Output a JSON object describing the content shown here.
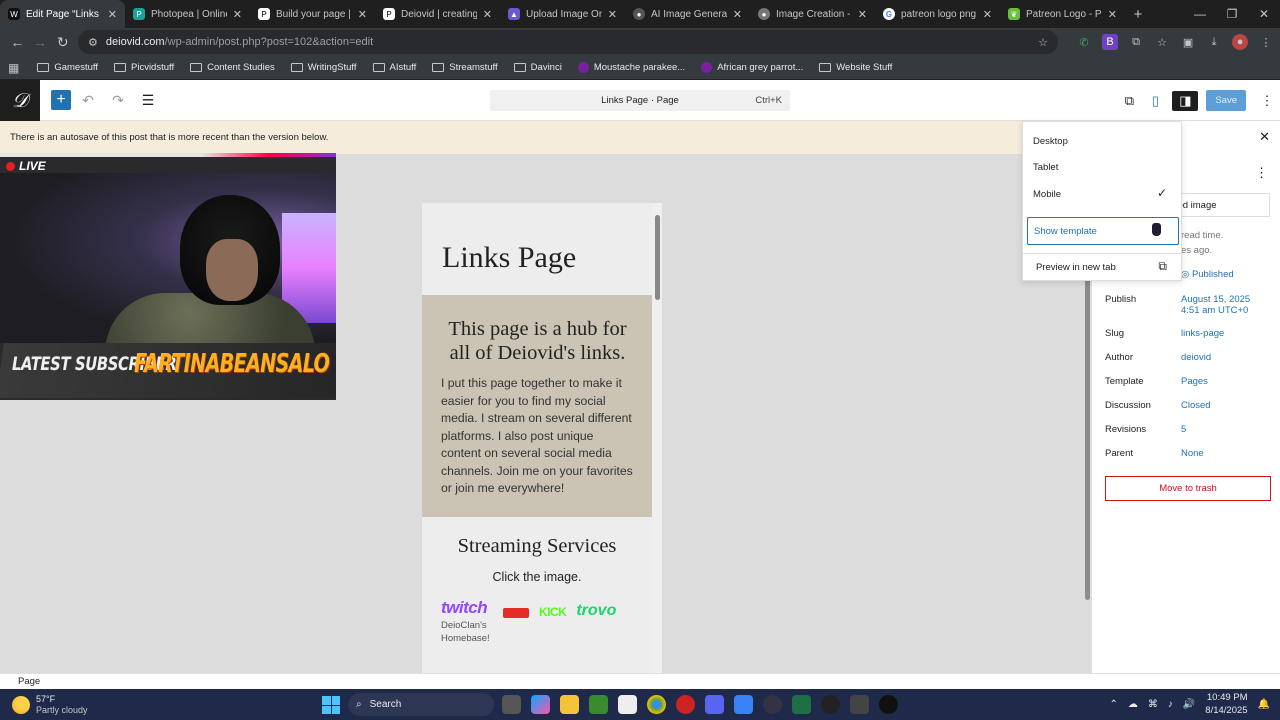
{
  "browser": {
    "tabs": [
      {
        "label": "Edit Page “Links Page”",
        "icon": "wordpress-icon",
        "color": "#353a3f",
        "active": true
      },
      {
        "label": "Photopea | Online Photo",
        "icon": "photopea-icon",
        "color": "#18a497"
      },
      {
        "label": "Build your page | Patreon",
        "icon": "patreon-icon",
        "color": "#1f1f1f"
      },
      {
        "label": "Deiovid | creating Stre",
        "icon": "patreon-icon",
        "color": "#1f1f1f"
      },
      {
        "label": "Upload Image Online",
        "icon": "upload-icon",
        "color": "#6a5acd"
      },
      {
        "label": "AI Image Generator -",
        "icon": "ai-icon",
        "color": "#555"
      },
      {
        "label": "Image Creation - Leon",
        "icon": "leonardo-icon",
        "color": "#777"
      },
      {
        "label": "patreon logo png - G",
        "icon": "google-icon",
        "color": "#fff"
      },
      {
        "label": "Patreon Logo - Patre",
        "icon": "leaf-icon",
        "color": "#6bbf3b"
      }
    ],
    "url_domain": "deiovid.com",
    "url_path": "/wp-admin/post.php?post=102&action=edit",
    "bookmarks": [
      {
        "label": "Gamestuff",
        "icon": "folder-icon"
      },
      {
        "label": "Picvidstuff",
        "icon": "folder-icon"
      },
      {
        "label": "Content Studies",
        "icon": "folder-icon"
      },
      {
        "label": "WritingStuff",
        "icon": "folder-icon"
      },
      {
        "label": "AIstuff",
        "icon": "folder-icon"
      },
      {
        "label": "Streamstuff",
        "icon": "folder-icon"
      },
      {
        "label": "Davinci",
        "icon": "folder-icon"
      },
      {
        "label": "Moustache parakee...",
        "icon": "purple-dot-icon"
      },
      {
        "label": "African grey parrot...",
        "icon": "purple-dot-icon"
      },
      {
        "label": "Website Stuff",
        "icon": "folder-icon"
      }
    ]
  },
  "toolbar": {
    "command_title": "Links Page · Page",
    "shortcut": "Ctrl+K",
    "save_label": "Save"
  },
  "editor": {
    "notice": "There is an autosave of this post that is more recent than the version below.",
    "page_title": "Links Page",
    "hub_heading": "This page is a hub for all of Deiovid's links.",
    "hub_body": "I put this page together to make it easier for you to find my social media. I stream on several different platforms. I also post unique content on several social media channels. Join me on your favorites or join me everywhere!",
    "streaming_heading": "Streaming Services",
    "click_text": "Click the image.",
    "twitch_logo": "twitch",
    "twitch_caption": "DeioClan's Homebase!",
    "kick_logo": "KICK",
    "trovo_logo": "trovo",
    "status_label": "Page"
  },
  "overlay": {
    "live_label": "LIVE",
    "subscriber_label": "LATEST SUBSCRIBER",
    "subscriber_name": "FARTINABEANSALO"
  },
  "preview_menu": {
    "options": [
      "Desktop",
      "Tablet",
      "Mobile"
    ],
    "checked": "Mobile",
    "show_template": "Show template",
    "preview_new_tab": "Preview in new tab"
  },
  "sidebar": {
    "featured_image_fragment": "ured image",
    "read_time_fragment": "read time.",
    "ago_fragment": "es ago.",
    "status": "Published",
    "rows": [
      {
        "key": "Publish",
        "value": "August 15, 2025",
        "value2": "4:51 am UTC+0"
      },
      {
        "key": "Slug",
        "value": "links-page"
      },
      {
        "key": "Author",
        "value": "deiovid"
      },
      {
        "key": "Template",
        "value": "Pages"
      },
      {
        "key": "Discussion",
        "value": "Closed"
      },
      {
        "key": "Revisions",
        "value": "5"
      },
      {
        "key": "Parent",
        "value": "None"
      }
    ],
    "trash_label": "Move to trash"
  },
  "taskbar": {
    "temperature": "57°F",
    "weather": "Partly cloudy",
    "search_label": "Search",
    "time": "10:49 PM",
    "date": "8/14/2025"
  }
}
